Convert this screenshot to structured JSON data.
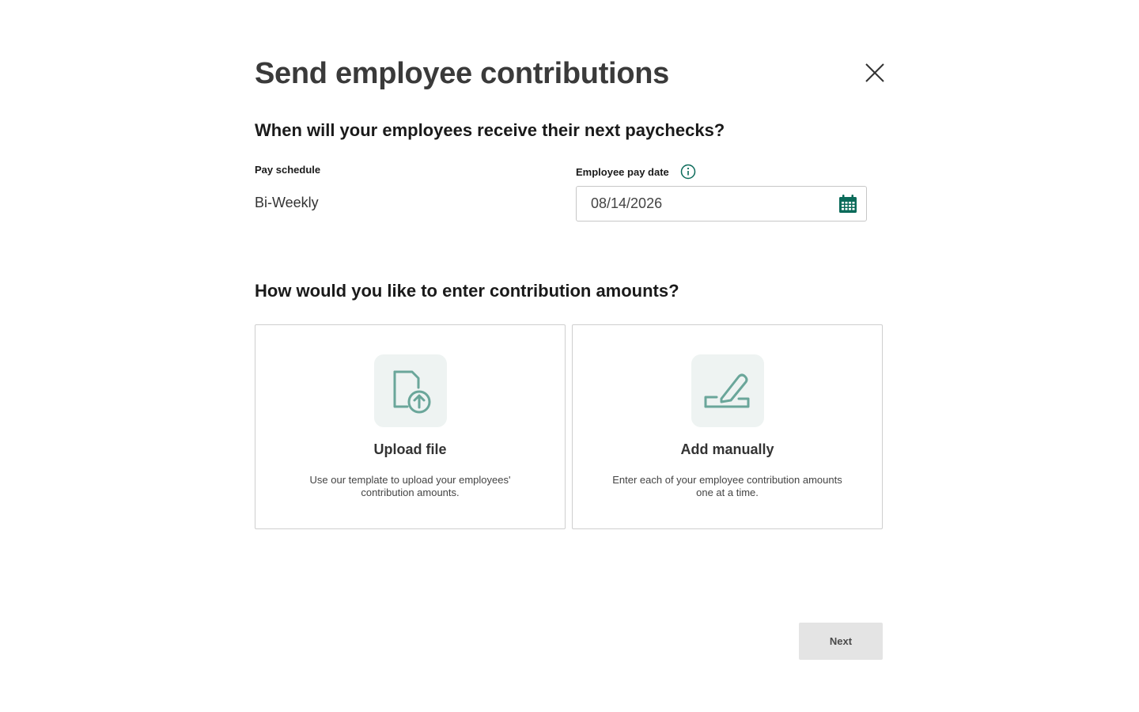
{
  "modal": {
    "title": "Send employee contributions",
    "close_icon": "close-icon"
  },
  "paycheck_section": {
    "heading": "When will your employees receive their next paychecks?",
    "pay_schedule_label": "Pay schedule",
    "pay_schedule_value": "Bi-Weekly",
    "pay_date_label": "Employee pay date",
    "pay_date_info_icon": "info-icon",
    "pay_date_value": "08/14/2026",
    "calendar_icon": "calendar-icon"
  },
  "entry_section": {
    "heading": "How would you like to enter contribution amounts?",
    "options": [
      {
        "icon": "file-upload-icon",
        "title": "Upload file",
        "description": "Use our template to upload your employees' contribution amounts."
      },
      {
        "icon": "pencil-sign-icon",
        "title": "Add manually",
        "description": "Enter each of your employee contribution amounts one at a time."
      }
    ]
  },
  "footer": {
    "next_label": "Next"
  },
  "colors": {
    "accent": "#0b6b5a",
    "icon_stroke": "#6aa69a",
    "icon_bg": "#eef3f2",
    "button_disabled_bg": "#e4e4e4"
  }
}
